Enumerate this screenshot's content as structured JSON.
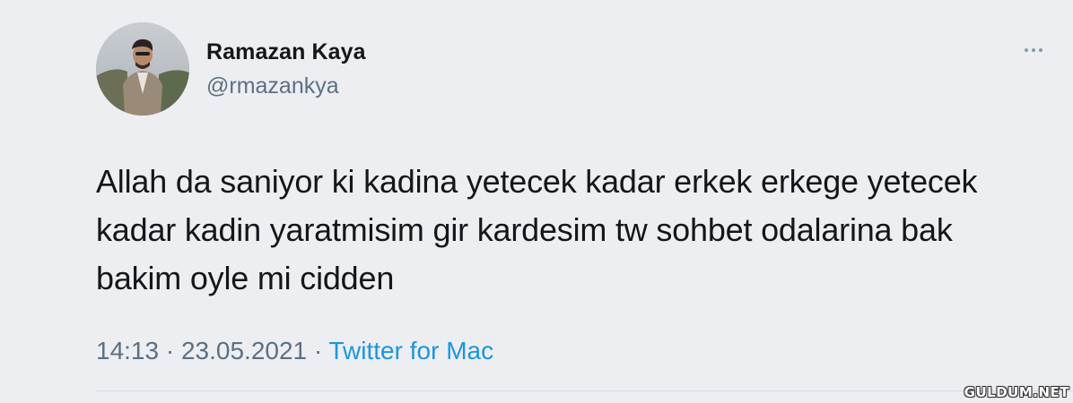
{
  "user": {
    "display_name": "Ramazan Kaya",
    "handle": "@rmazankya"
  },
  "tweet": {
    "lines": [
      "Allah da saniyor ki kadina yetecek kadar erkek erkege yetecek",
      "kadar kadin yaratmisim gir kardesim tw sohbet odalarina bak",
      "bakim oyle mi cidden"
    ],
    "time": "14:13",
    "separator1": " · ",
    "date": "23.05.2021",
    "separator2": " · ",
    "source": "Twitter for Mac"
  },
  "icons": {
    "more": "more-options-icon",
    "avatar": "profile-avatar"
  },
  "colors": {
    "background": "#edeef2",
    "text": "#14171a",
    "secondary": "#5b7083",
    "link": "#1b95e0"
  },
  "watermark": "GULDUM.NET"
}
